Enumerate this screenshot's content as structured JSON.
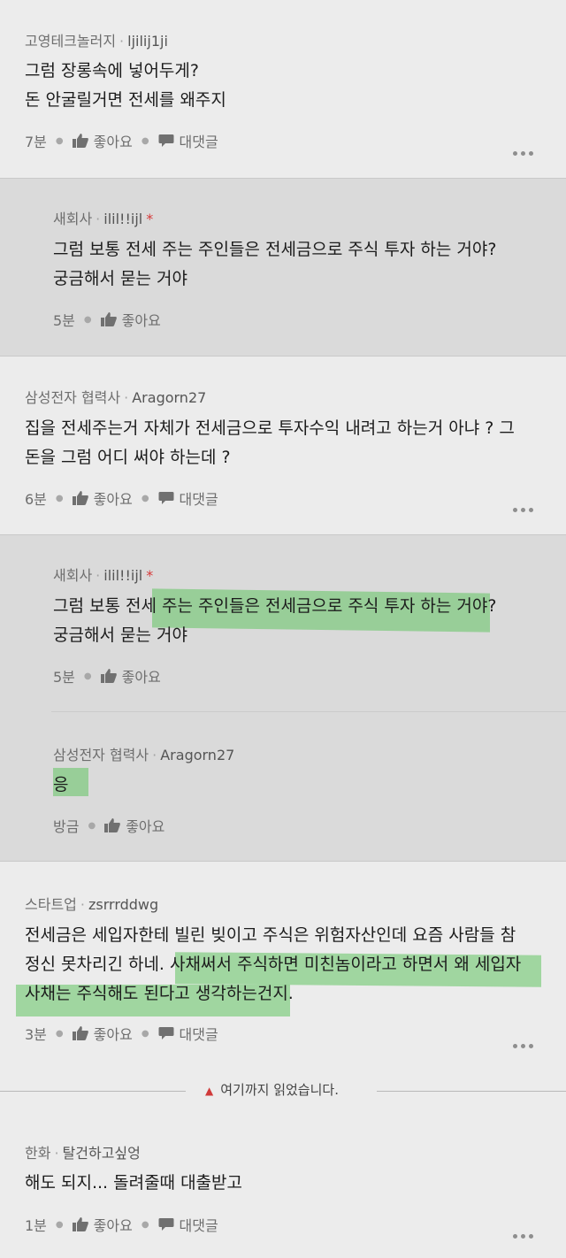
{
  "comments": [
    {
      "company": "고영테크놀러지",
      "nickname": "ljilij1ji",
      "lines": [
        "그럼 장롱속에 넣어두게?",
        "돈 안굴릴거면 전세를 왜주지"
      ],
      "time": "7분",
      "like_label": "좋아요",
      "reply_label": "대댓글"
    },
    {
      "company": "새회사",
      "nickname": "ilil!!ijl",
      "author_mark": "*",
      "lines": [
        "그럼 보통 전세 주는 주인들은 전세금으로 주식 투자 하는 거야?",
        "궁금해서 묻는 거야"
      ],
      "time": "5분",
      "like_label": "좋아요"
    },
    {
      "company": "삼성전자 협력사",
      "nickname": "Aragorn27",
      "lines": [
        "집을 전세주는거 자체가 전세금으로 투자수익 내려고 하는거 아냐 ? 그",
        "돈을 그럼 어디 써야 하는데 ?"
      ],
      "time": "6분",
      "like_label": "좋아요",
      "reply_label": "대댓글"
    },
    {
      "company": "새회사",
      "nickname": "ilil!!ijl",
      "author_mark": "*",
      "lines": [
        "그럼 보통 전세 주는 주인들은 전세금으로 주식 투자 하는 거야?",
        "궁금해서 묻는 거야"
      ],
      "time": "5분",
      "like_label": "좋아요"
    },
    {
      "company": "삼성전자 협력사",
      "nickname": "Aragorn27",
      "lines": [
        "응"
      ],
      "time": "방금",
      "like_label": "좋아요"
    },
    {
      "company": "스타트업",
      "nickname": "zsrrrddwg",
      "lines": [
        "전세금은 세입자한테 빌린 빚이고 주식은 위험자산인데 요즘 사람들 참",
        "정신 못차리긴 하네. 사채써서 주식하면 미친놈이라고 하면서 왜 세입자",
        "사채는 주식해도 된다고 생각하는건지."
      ],
      "time": "3분",
      "like_label": "좋아요",
      "reply_label": "대댓글"
    },
    {
      "company": "한화",
      "nickname": "탈건하고싶엉",
      "lines": [
        "해도 되지... 돌려줄때 대출받고"
      ],
      "time": "1분",
      "like_label": "좋아요",
      "reply_label": "대댓글"
    }
  ],
  "read_marker": "여기까지 읽었습니다.",
  "colors": {
    "highlight": "#62c462",
    "reply_bg": "#dadada",
    "page_bg": "#ececec",
    "marker": "#d03a3a"
  }
}
